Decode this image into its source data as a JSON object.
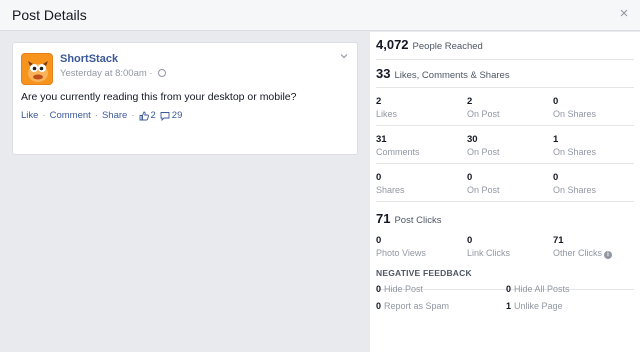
{
  "header": {
    "title": "Post Details",
    "close_glyph": "×"
  },
  "post": {
    "page_name": "ShortStack",
    "timestamp": "Yesterday at 8:00am",
    "meta_sep": " · ",
    "text": "Are you currently reading this from your desktop or mobile?",
    "actions": {
      "like": "Like",
      "comment": "Comment",
      "share": "Share",
      "sep": "·",
      "like_count": "2",
      "comment_count": "29"
    },
    "avatar_color": "#f7941d"
  },
  "stats": {
    "reach": {
      "value": "4,072",
      "label": "People Reached"
    },
    "engagement": {
      "value": "33",
      "label": "Likes, Comments & Shares"
    },
    "rows": [
      [
        {
          "num": "2",
          "label": "Likes"
        },
        {
          "num": "2",
          "label": "On Post"
        },
        {
          "num": "0",
          "label": "On Shares"
        }
      ],
      [
        {
          "num": "31",
          "label": "Comments"
        },
        {
          "num": "30",
          "label": "On Post"
        },
        {
          "num": "1",
          "label": "On Shares"
        }
      ],
      [
        {
          "num": "0",
          "label": "Shares"
        },
        {
          "num": "0",
          "label": "On Post"
        },
        {
          "num": "0",
          "label": "On Shares"
        }
      ]
    ],
    "clicks": {
      "value": "71",
      "label": "Post Clicks"
    },
    "click_rows": [
      {
        "num": "0",
        "label": "Photo Views"
      },
      {
        "num": "0",
        "label": "Link Clicks"
      },
      {
        "num": "71",
        "label": "Other Clicks"
      }
    ],
    "info_glyph": "i"
  },
  "negative": {
    "title": "NEGATIVE FEEDBACK",
    "items": [
      {
        "num": "0",
        "label": "Hide Post"
      },
      {
        "num": "0",
        "label": "Hide All Posts"
      },
      {
        "num": "0",
        "label": "Report as Spam"
      },
      {
        "num": "1",
        "label": "Unlike Page"
      }
    ]
  },
  "colors": {
    "link": "#3b5998",
    "muted": "#9197a3",
    "background": "#e9eaed"
  }
}
